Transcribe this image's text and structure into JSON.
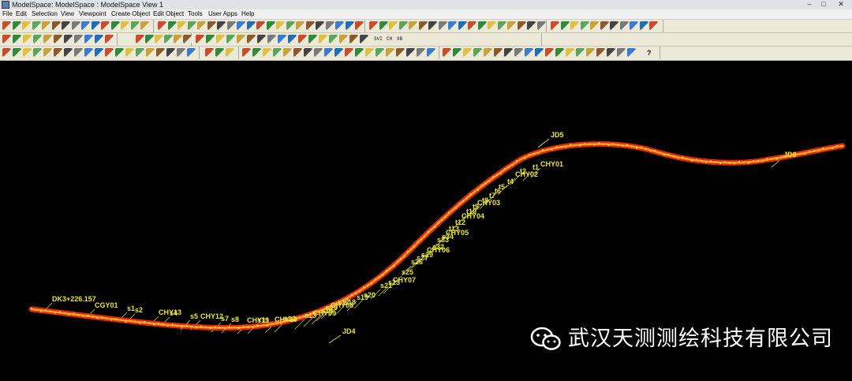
{
  "window": {
    "title": "ModelSpace: ModelSpace : ModelSpace  View 1",
    "controls": {
      "minimize": "–",
      "maximize": "□",
      "close": "✕"
    }
  },
  "menubar": {
    "items": [
      {
        "label": "File"
      },
      {
        "label": "Edit"
      },
      {
        "label": "Selection"
      },
      {
        "label": "View"
      },
      {
        "label": "Viewpoint"
      },
      {
        "label": "Create Object"
      },
      {
        "label": "Edit Object"
      },
      {
        "label": "Tools"
      },
      {
        "label": "User Apps"
      },
      {
        "label": "Help"
      }
    ]
  },
  "toolbar": {
    "text_buttons": [
      "SVI",
      "CH",
      "XB"
    ],
    "help_label": "?"
  },
  "drawing": {
    "background": "#000000",
    "alignment_color": "#e8421e",
    "label_color": "#e8e63a",
    "labels": [
      {
        "text": "DK3+226.157"
      },
      {
        "text": "CGY01"
      },
      {
        "text": "s1"
      },
      {
        "text": "s2"
      },
      {
        "text": "CHY13"
      },
      {
        "text": "s4"
      },
      {
        "text": "s5"
      },
      {
        "text": "CHY12"
      },
      {
        "text": "s7"
      },
      {
        "text": "s8"
      },
      {
        "text": "CHY11"
      },
      {
        "text": "s19"
      },
      {
        "text": "CHY10"
      },
      {
        "text": "s12"
      },
      {
        "text": "s13"
      },
      {
        "text": "CHY09"
      },
      {
        "text": "s15"
      },
      {
        "text": "s16"
      },
      {
        "text": "CHY08"
      },
      {
        "text": "s17"
      },
      {
        "text": "s18"
      },
      {
        "text": "s19"
      },
      {
        "text": "s20"
      },
      {
        "text": "s21"
      },
      {
        "text": "s23"
      },
      {
        "text": "CHY07"
      },
      {
        "text": "s25"
      },
      {
        "text": "s26"
      },
      {
        "text": "s27"
      },
      {
        "text": "s29"
      },
      {
        "text": "CHY06"
      },
      {
        "text": "s32"
      },
      {
        "text": "s33"
      },
      {
        "text": "s34"
      },
      {
        "text": "CHY05"
      },
      {
        "text": "t13"
      },
      {
        "text": "t12"
      },
      {
        "text": "CHY04"
      },
      {
        "text": "t10"
      },
      {
        "text": "t9"
      },
      {
        "text": "CHY03"
      },
      {
        "text": "t8"
      },
      {
        "text": "t7"
      },
      {
        "text": "t6"
      },
      {
        "text": "t5"
      },
      {
        "text": "t4"
      },
      {
        "text": "CHY02"
      },
      {
        "text": "t2"
      },
      {
        "text": "t1"
      },
      {
        "text": "CHY01"
      },
      {
        "text": "JD5"
      },
      {
        "text": "JD6"
      },
      {
        "text": "JD4"
      }
    ]
  },
  "watermark": {
    "text": "武汉天测测绘科技有限公司",
    "icon": "wechat-icon"
  }
}
